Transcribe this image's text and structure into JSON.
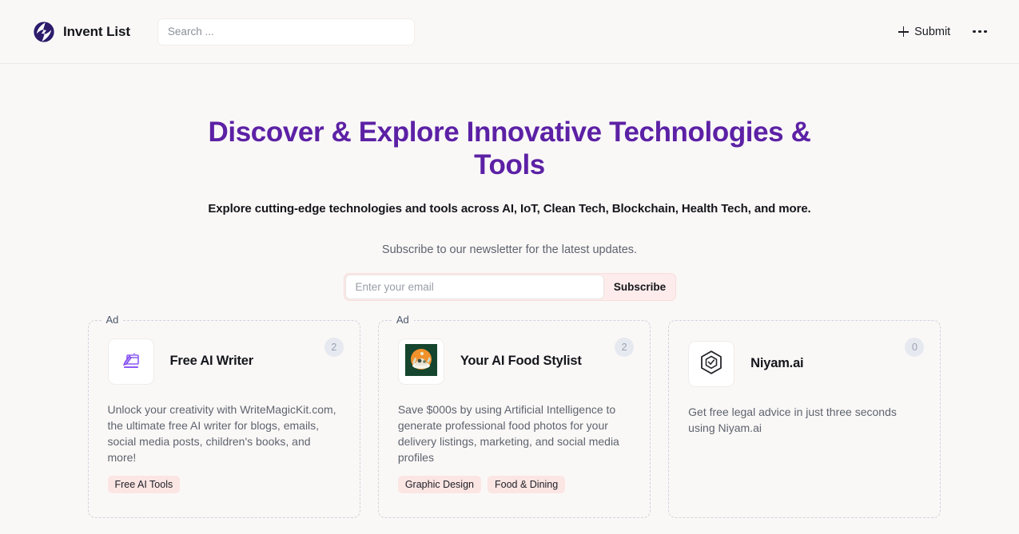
{
  "brand": {
    "name": "Invent List",
    "logo_icon": "bolt-badge-icon",
    "logo_color": "#2d1b6b"
  },
  "header": {
    "search": {
      "placeholder": "Search ...",
      "value": ""
    },
    "submit_label": "Submit",
    "submit_icon": "plus-icon",
    "more_icon": "ellipsis-icon"
  },
  "hero": {
    "title": "Discover & Explore Innovative Technologies & Tools",
    "title_color": "#5c21a5",
    "subtitle": "Explore cutting-edge technologies and tools across AI, IoT, Clean Tech, Blockchain, Health Tech, and more.",
    "newsletter_note": "Subscribe to our newsletter for the latest updates."
  },
  "subscribe": {
    "email_placeholder": "Enter your email",
    "email_value": "",
    "button_label": "Subscribe",
    "accent_color": "#fdeceb"
  },
  "cards": [
    {
      "ad_label": "Ad",
      "count": "2",
      "icon": "writemagickit-logo-icon",
      "title": "Free AI Writer",
      "description": "Unlock your creativity with WriteMagicKit.com, the ultimate free AI writer for blogs, emails, social media posts, children's books, and more!",
      "tags": [
        "Free AI Tools"
      ]
    },
    {
      "ad_label": "Ad",
      "count": "2",
      "icon": "food-photo-icon",
      "title": "Your AI Food Stylist",
      "description": "Save $000s by using Artificial Intelligence to generate professional food photos for your delivery listings, marketing, and social media profiles",
      "tags": [
        "Graphic Design",
        "Food & Dining"
      ]
    },
    {
      "ad_label": "",
      "count": "0",
      "icon": "hexagon-niyam-icon",
      "title": "Niyam.ai",
      "description": "Get free legal advice in just three seconds using Niyam.ai",
      "tags": []
    }
  ]
}
